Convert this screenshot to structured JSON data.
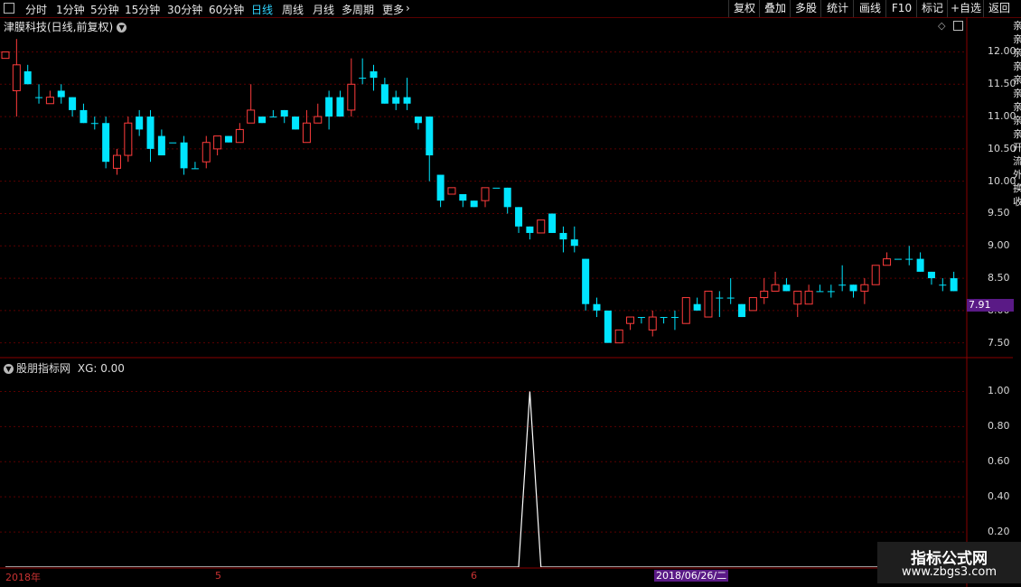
{
  "toolbar": {
    "periods": [
      "分时",
      "1分钟",
      "5分钟",
      "15分钟",
      "30分钟",
      "60分钟",
      "日线",
      "周线",
      "月线",
      "多周期",
      "更多"
    ],
    "active_period": "日线",
    "more_chevron": "›",
    "right_buttons": [
      "复权",
      "叠加",
      "多股",
      "统计",
      "画线",
      "F10",
      "标记",
      "+自选",
      "返回"
    ]
  },
  "main_chart": {
    "title": "津膜科技(日线,前复权)",
    "y_ticks": [
      "12.00",
      "11.50",
      "11.00",
      "10.50",
      "10.00",
      "9.50",
      "9.00",
      "8.50",
      "8.00",
      "7.50"
    ],
    "last_price": "7.91",
    "up_color": "#ff3c3c",
    "down_color": "#00e5ff"
  },
  "indicator": {
    "title": "股朋指标网",
    "value_label": "XG: 0.00",
    "y_ticks": [
      "1.00",
      "0.80",
      "0.60",
      "0.40",
      "0.20"
    ]
  },
  "x_axis": {
    "labels": [
      "2018年",
      "5",
      "6"
    ],
    "cursor_date": "2018/06/26/二"
  },
  "right_strip": [
    "亲",
    "亲",
    "亲",
    "亲",
    "亲",
    "亲",
    "亲",
    "亲",
    "亲",
    "开",
    "流",
    "外",
    "换",
    "收"
  ],
  "watermark": {
    "line1": "指标公式网",
    "line2": "www.zbgs3.com"
  },
  "chart_data": {
    "type": "candlestick",
    "ylim": [
      7.3,
      12.3
    ],
    "candles": [
      [
        11.9,
        12.0,
        12.0,
        11.9
      ],
      [
        11.4,
        11.8,
        12.2,
        11.0
      ],
      [
        11.7,
        11.5,
        11.8,
        11.5
      ],
      [
        11.3,
        11.3,
        11.5,
        11.2
      ],
      [
        11.2,
        11.3,
        11.4,
        11.2
      ],
      [
        11.4,
        11.3,
        11.5,
        11.2
      ],
      [
        11.3,
        11.1,
        11.3,
        11.0
      ],
      [
        11.1,
        10.9,
        11.2,
        10.9
      ],
      [
        10.9,
        10.9,
        11.0,
        10.8
      ],
      [
        10.9,
        10.3,
        11.0,
        10.2
      ],
      [
        10.2,
        10.4,
        10.5,
        10.1
      ],
      [
        10.4,
        10.9,
        11.0,
        10.3
      ],
      [
        11.0,
        10.8,
        11.1,
        10.7
      ],
      [
        11.0,
        10.5,
        11.1,
        10.3
      ],
      [
        10.7,
        10.4,
        10.8,
        10.4
      ],
      [
        10.6,
        10.6,
        10.6,
        10.6
      ],
      [
        10.6,
        10.2,
        10.7,
        10.1
      ],
      [
        10.2,
        10.2,
        10.3,
        10.2
      ],
      [
        10.3,
        10.6,
        10.7,
        10.2
      ],
      [
        10.5,
        10.7,
        10.7,
        10.4
      ],
      [
        10.7,
        10.6,
        10.7,
        10.6
      ],
      [
        10.6,
        10.8,
        10.9,
        10.6
      ],
      [
        10.9,
        11.1,
        11.5,
        10.9
      ],
      [
        11.0,
        10.9,
        11.0,
        10.9
      ],
      [
        11.0,
        11.0,
        11.1,
        11.0
      ],
      [
        11.1,
        11.0,
        11.1,
        10.9
      ],
      [
        11.0,
        10.8,
        11.0,
        10.8
      ],
      [
        10.6,
        10.9,
        11.1,
        10.6
      ],
      [
        10.9,
        11.0,
        11.2,
        10.9
      ],
      [
        11.3,
        11.0,
        11.4,
        10.8
      ],
      [
        11.3,
        11.0,
        11.4,
        11.0
      ],
      [
        11.1,
        11.5,
        11.9,
        11.0
      ],
      [
        11.6,
        11.6,
        11.9,
        11.5
      ],
      [
        11.7,
        11.6,
        11.8,
        11.4
      ],
      [
        11.5,
        11.2,
        11.6,
        11.2
      ],
      [
        11.3,
        11.2,
        11.4,
        11.1
      ],
      [
        11.3,
        11.2,
        11.6,
        11.1
      ],
      [
        11.0,
        10.9,
        11.0,
        10.8
      ],
      [
        11.0,
        10.4,
        11.0,
        10.0
      ],
      [
        10.1,
        9.7,
        10.1,
        9.6
      ],
      [
        9.8,
        9.9,
        9.9,
        9.8
      ],
      [
        9.8,
        9.7,
        9.8,
        9.6
      ],
      [
        9.7,
        9.6,
        9.7,
        9.6
      ],
      [
        9.7,
        9.9,
        9.9,
        9.6
      ],
      [
        9.9,
        9.9,
        9.9,
        9.9
      ],
      [
        9.9,
        9.6,
        9.9,
        9.5
      ],
      [
        9.6,
        9.3,
        9.6,
        9.2
      ],
      [
        9.3,
        9.2,
        9.3,
        9.1
      ],
      [
        9.2,
        9.4,
        9.4,
        9.2
      ],
      [
        9.5,
        9.2,
        9.5,
        9.2
      ],
      [
        9.2,
        9.1,
        9.3,
        8.9
      ],
      [
        9.1,
        9.0,
        9.3,
        8.9
      ],
      [
        8.8,
        8.1,
        8.8,
        8.0
      ],
      [
        8.1,
        8.0,
        8.2,
        7.9
      ],
      [
        8.0,
        7.5,
        8.0,
        7.5
      ],
      [
        7.5,
        7.7,
        7.7,
        7.5
      ],
      [
        7.8,
        7.9,
        7.9,
        7.7
      ],
      [
        7.9,
        7.9,
        7.9,
        7.8
      ],
      [
        7.7,
        7.9,
        8.0,
        7.6
      ],
      [
        7.9,
        7.9,
        7.9,
        7.8
      ],
      [
        7.9,
        7.9,
        8.0,
        7.7
      ],
      [
        7.8,
        8.2,
        8.2,
        7.8
      ],
      [
        8.1,
        8.0,
        8.2,
        8.0
      ],
      [
        7.9,
        8.3,
        8.3,
        7.9
      ],
      [
        8.2,
        8.2,
        8.3,
        7.9
      ],
      [
        8.2,
        8.2,
        8.5,
        8.1
      ],
      [
        8.1,
        7.9,
        8.1,
        7.9
      ],
      [
        8.0,
        8.2,
        8.2,
        8.0
      ],
      [
        8.2,
        8.3,
        8.5,
        8.1
      ],
      [
        8.3,
        8.4,
        8.6,
        8.3
      ],
      [
        8.4,
        8.3,
        8.5,
        8.3
      ],
      [
        8.1,
        8.3,
        8.3,
        7.9
      ],
      [
        8.1,
        8.3,
        8.4,
        8.1
      ],
      [
        8.3,
        8.3,
        8.4,
        8.3
      ],
      [
        8.3,
        8.3,
        8.4,
        8.2
      ],
      [
        8.4,
        8.4,
        8.7,
        8.3
      ],
      [
        8.4,
        8.3,
        8.4,
        8.2
      ],
      [
        8.3,
        8.4,
        8.5,
        8.1
      ],
      [
        8.4,
        8.7,
        8.7,
        8.4
      ],
      [
        8.7,
        8.8,
        8.9,
        8.7
      ],
      [
        8.8,
        8.8,
        8.8,
        8.8
      ],
      [
        8.8,
        8.8,
        9.0,
        8.7
      ],
      [
        8.8,
        8.6,
        8.9,
        8.6
      ],
      [
        8.6,
        8.5,
        8.6,
        8.4
      ],
      [
        8.4,
        8.4,
        8.5,
        8.3
      ],
      [
        8.5,
        8.3,
        8.6,
        8.3
      ]
    ],
    "indicator_ylim": [
      0,
      1.1
    ],
    "indicator_values_note": "XG is 0 except a single spike to 1.00",
    "indicator_spike_index": 47,
    "indicator_spike_value": 1.0
  }
}
